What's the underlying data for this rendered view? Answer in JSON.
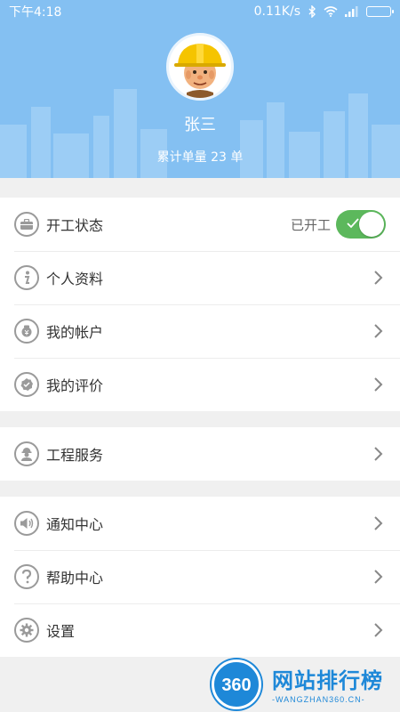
{
  "status_bar": {
    "time": "下午4:18",
    "network_speed": "0.11K/s",
    "icons": [
      "bluetooth-icon",
      "wifi-icon",
      "signal-icon",
      "battery-icon"
    ]
  },
  "profile": {
    "name": "张三",
    "order_count": "累计单量 23 单"
  },
  "menu": {
    "work_status": {
      "label": "开工状态",
      "status": "已开工",
      "toggle_on": true
    },
    "personal_info": {
      "label": "个人资料"
    },
    "my_account": {
      "label": "我的帐户"
    },
    "my_reviews": {
      "label": "我的评价"
    },
    "engineering_service": {
      "label": "工程服务"
    },
    "notification_center": {
      "label": "通知中心"
    },
    "help_center": {
      "label": "帮助中心"
    },
    "settings": {
      "label": "设置"
    }
  },
  "watermark": {
    "logo": "360",
    "title": "网站排行榜",
    "subtitle": "-WANGZHAN360.CN-"
  },
  "colors": {
    "header_bg": "#84c0f2",
    "toggle_on": "#5cb85c",
    "watermark": "#1e88d8"
  }
}
